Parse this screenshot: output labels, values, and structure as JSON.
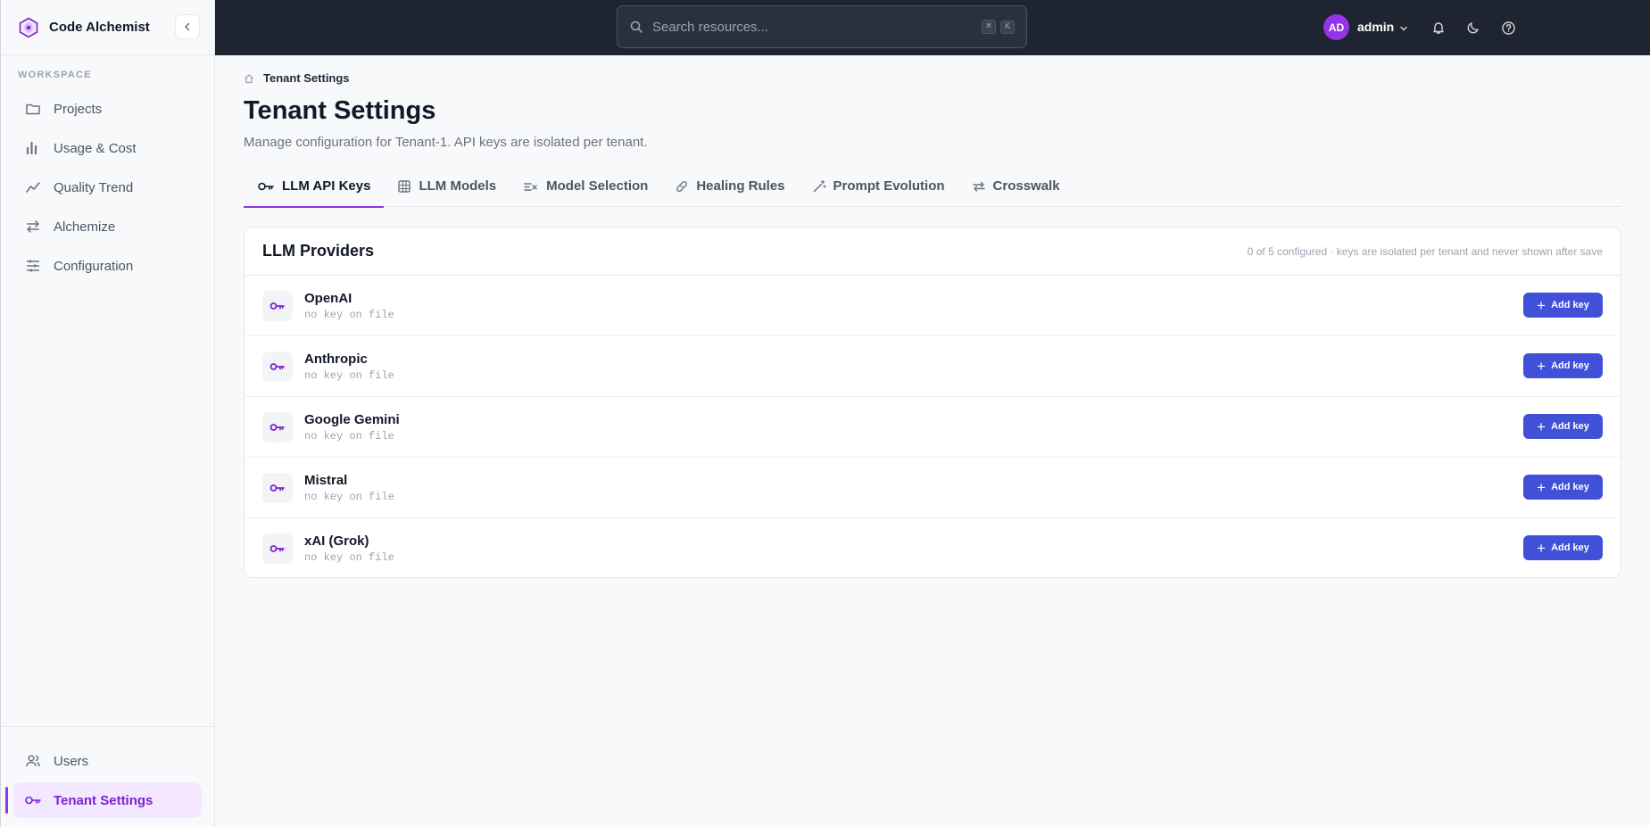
{
  "brand": {
    "name": "Code Alchemist"
  },
  "sidebar": {
    "section_label": "WORKSPACE",
    "items": [
      {
        "label": "Projects",
        "icon": "folder-icon"
      },
      {
        "label": "Usage & Cost",
        "icon": "bar-chart-icon"
      },
      {
        "label": "Quality Trend",
        "icon": "trend-icon"
      },
      {
        "label": "Alchemize",
        "icon": "swap-icon"
      },
      {
        "label": "Configuration",
        "icon": "sliders-icon"
      }
    ],
    "bottom_items": [
      {
        "label": "Users",
        "icon": "users-icon"
      },
      {
        "label": "Tenant Settings",
        "icon": "key-icon",
        "active": true
      }
    ]
  },
  "topbar": {
    "search_placeholder": "Search resources...",
    "shortcut_keys": [
      "⌘",
      "K"
    ],
    "avatar_initials": "AD",
    "user_name": "admin"
  },
  "main": {
    "breadcrumb": "Tenant Settings",
    "title": "Tenant Settings",
    "subtitle": "Manage configuration for Tenant-1. API keys are isolated per tenant.",
    "tabs": [
      {
        "label": "LLM API Keys",
        "active": true
      },
      {
        "label": "LLM Models"
      },
      {
        "label": "Model Selection"
      },
      {
        "label": "Healing Rules"
      },
      {
        "label": "Prompt Evolution"
      },
      {
        "label": "Crosswalk"
      }
    ],
    "card": {
      "title": "LLM Providers",
      "note": "0 of 5 configured · keys are isolated per tenant and never shown after save",
      "add_label": "Add key",
      "providers": [
        {
          "name": "OpenAI",
          "status": "no key on file"
        },
        {
          "name": "Anthropic",
          "status": "no key on file"
        },
        {
          "name": "Google Gemini",
          "status": "no key on file"
        },
        {
          "name": "Mistral",
          "status": "no key on file"
        },
        {
          "name": "xAI (Grok)",
          "status": "no key on file"
        }
      ]
    }
  },
  "colors": {
    "accent": "#9333ea",
    "button": "#4150d8",
    "topbar": "#1f2530"
  }
}
